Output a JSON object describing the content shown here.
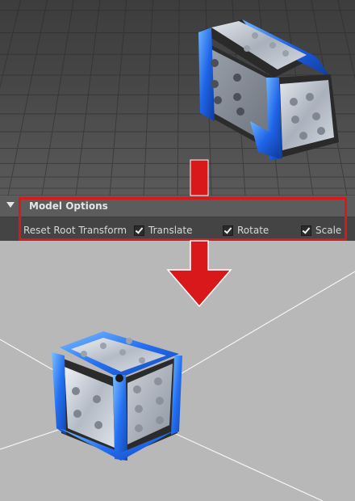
{
  "panel": {
    "title": "Model Options",
    "label": "Reset Root Transform",
    "options": [
      {
        "label": "Translate",
        "checked": true
      },
      {
        "label": "Rotate",
        "checked": true
      },
      {
        "label": "Scale",
        "checked": true
      }
    ]
  },
  "icons": {
    "collapse": "triangle-down-icon",
    "checkbox": "checkmark-icon",
    "arrow": "red-down-arrow"
  },
  "colors": {
    "highlight": "#d9181b",
    "dice_trim": "#2f7dff",
    "dice_body": "#c9ced6",
    "panel_bg": "#444444",
    "header_bg": "#5c5c5c"
  }
}
